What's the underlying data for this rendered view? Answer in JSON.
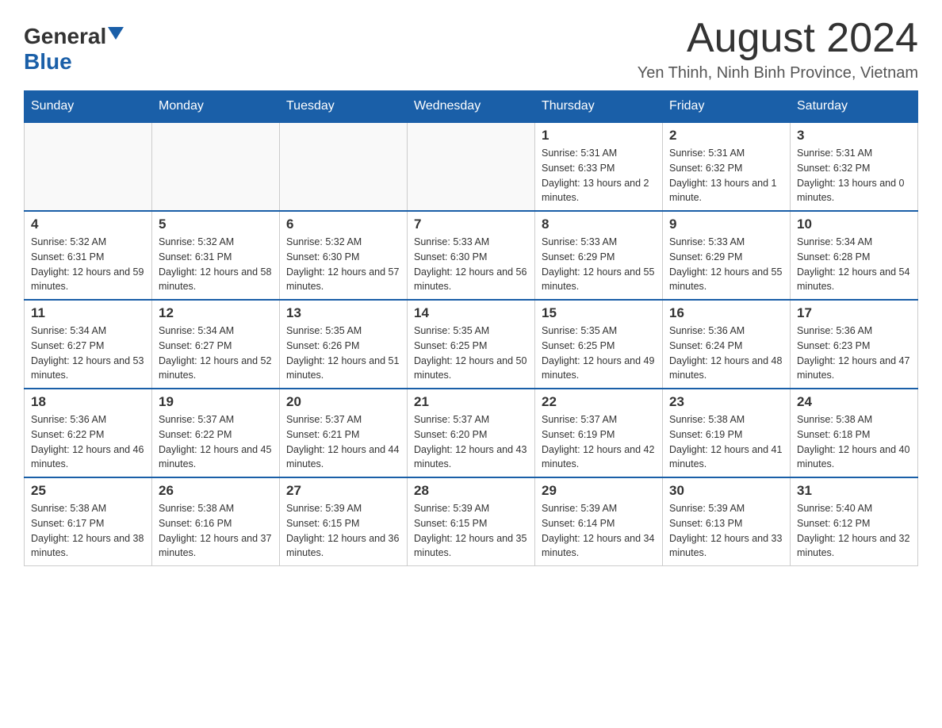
{
  "logo": {
    "general": "General",
    "blue": "Blue"
  },
  "title": {
    "month_year": "August 2024",
    "location": "Yen Thinh, Ninh Binh Province, Vietnam"
  },
  "days_of_week": [
    "Sunday",
    "Monday",
    "Tuesday",
    "Wednesday",
    "Thursday",
    "Friday",
    "Saturday"
  ],
  "weeks": [
    [
      {
        "day": "",
        "info": ""
      },
      {
        "day": "",
        "info": ""
      },
      {
        "day": "",
        "info": ""
      },
      {
        "day": "",
        "info": ""
      },
      {
        "day": "1",
        "info": "Sunrise: 5:31 AM\nSunset: 6:33 PM\nDaylight: 13 hours and 2 minutes."
      },
      {
        "day": "2",
        "info": "Sunrise: 5:31 AM\nSunset: 6:32 PM\nDaylight: 13 hours and 1 minute."
      },
      {
        "day": "3",
        "info": "Sunrise: 5:31 AM\nSunset: 6:32 PM\nDaylight: 13 hours and 0 minutes."
      }
    ],
    [
      {
        "day": "4",
        "info": "Sunrise: 5:32 AM\nSunset: 6:31 PM\nDaylight: 12 hours and 59 minutes."
      },
      {
        "day": "5",
        "info": "Sunrise: 5:32 AM\nSunset: 6:31 PM\nDaylight: 12 hours and 58 minutes."
      },
      {
        "day": "6",
        "info": "Sunrise: 5:32 AM\nSunset: 6:30 PM\nDaylight: 12 hours and 57 minutes."
      },
      {
        "day": "7",
        "info": "Sunrise: 5:33 AM\nSunset: 6:30 PM\nDaylight: 12 hours and 56 minutes."
      },
      {
        "day": "8",
        "info": "Sunrise: 5:33 AM\nSunset: 6:29 PM\nDaylight: 12 hours and 55 minutes."
      },
      {
        "day": "9",
        "info": "Sunrise: 5:33 AM\nSunset: 6:29 PM\nDaylight: 12 hours and 55 minutes."
      },
      {
        "day": "10",
        "info": "Sunrise: 5:34 AM\nSunset: 6:28 PM\nDaylight: 12 hours and 54 minutes."
      }
    ],
    [
      {
        "day": "11",
        "info": "Sunrise: 5:34 AM\nSunset: 6:27 PM\nDaylight: 12 hours and 53 minutes."
      },
      {
        "day": "12",
        "info": "Sunrise: 5:34 AM\nSunset: 6:27 PM\nDaylight: 12 hours and 52 minutes."
      },
      {
        "day": "13",
        "info": "Sunrise: 5:35 AM\nSunset: 6:26 PM\nDaylight: 12 hours and 51 minutes."
      },
      {
        "day": "14",
        "info": "Sunrise: 5:35 AM\nSunset: 6:25 PM\nDaylight: 12 hours and 50 minutes."
      },
      {
        "day": "15",
        "info": "Sunrise: 5:35 AM\nSunset: 6:25 PM\nDaylight: 12 hours and 49 minutes."
      },
      {
        "day": "16",
        "info": "Sunrise: 5:36 AM\nSunset: 6:24 PM\nDaylight: 12 hours and 48 minutes."
      },
      {
        "day": "17",
        "info": "Sunrise: 5:36 AM\nSunset: 6:23 PM\nDaylight: 12 hours and 47 minutes."
      }
    ],
    [
      {
        "day": "18",
        "info": "Sunrise: 5:36 AM\nSunset: 6:22 PM\nDaylight: 12 hours and 46 minutes."
      },
      {
        "day": "19",
        "info": "Sunrise: 5:37 AM\nSunset: 6:22 PM\nDaylight: 12 hours and 45 minutes."
      },
      {
        "day": "20",
        "info": "Sunrise: 5:37 AM\nSunset: 6:21 PM\nDaylight: 12 hours and 44 minutes."
      },
      {
        "day": "21",
        "info": "Sunrise: 5:37 AM\nSunset: 6:20 PM\nDaylight: 12 hours and 43 minutes."
      },
      {
        "day": "22",
        "info": "Sunrise: 5:37 AM\nSunset: 6:19 PM\nDaylight: 12 hours and 42 minutes."
      },
      {
        "day": "23",
        "info": "Sunrise: 5:38 AM\nSunset: 6:19 PM\nDaylight: 12 hours and 41 minutes."
      },
      {
        "day": "24",
        "info": "Sunrise: 5:38 AM\nSunset: 6:18 PM\nDaylight: 12 hours and 40 minutes."
      }
    ],
    [
      {
        "day": "25",
        "info": "Sunrise: 5:38 AM\nSunset: 6:17 PM\nDaylight: 12 hours and 38 minutes."
      },
      {
        "day": "26",
        "info": "Sunrise: 5:38 AM\nSunset: 6:16 PM\nDaylight: 12 hours and 37 minutes."
      },
      {
        "day": "27",
        "info": "Sunrise: 5:39 AM\nSunset: 6:15 PM\nDaylight: 12 hours and 36 minutes."
      },
      {
        "day": "28",
        "info": "Sunrise: 5:39 AM\nSunset: 6:15 PM\nDaylight: 12 hours and 35 minutes."
      },
      {
        "day": "29",
        "info": "Sunrise: 5:39 AM\nSunset: 6:14 PM\nDaylight: 12 hours and 34 minutes."
      },
      {
        "day": "30",
        "info": "Sunrise: 5:39 AM\nSunset: 6:13 PM\nDaylight: 12 hours and 33 minutes."
      },
      {
        "day": "31",
        "info": "Sunrise: 5:40 AM\nSunset: 6:12 PM\nDaylight: 12 hours and 32 minutes."
      }
    ]
  ]
}
